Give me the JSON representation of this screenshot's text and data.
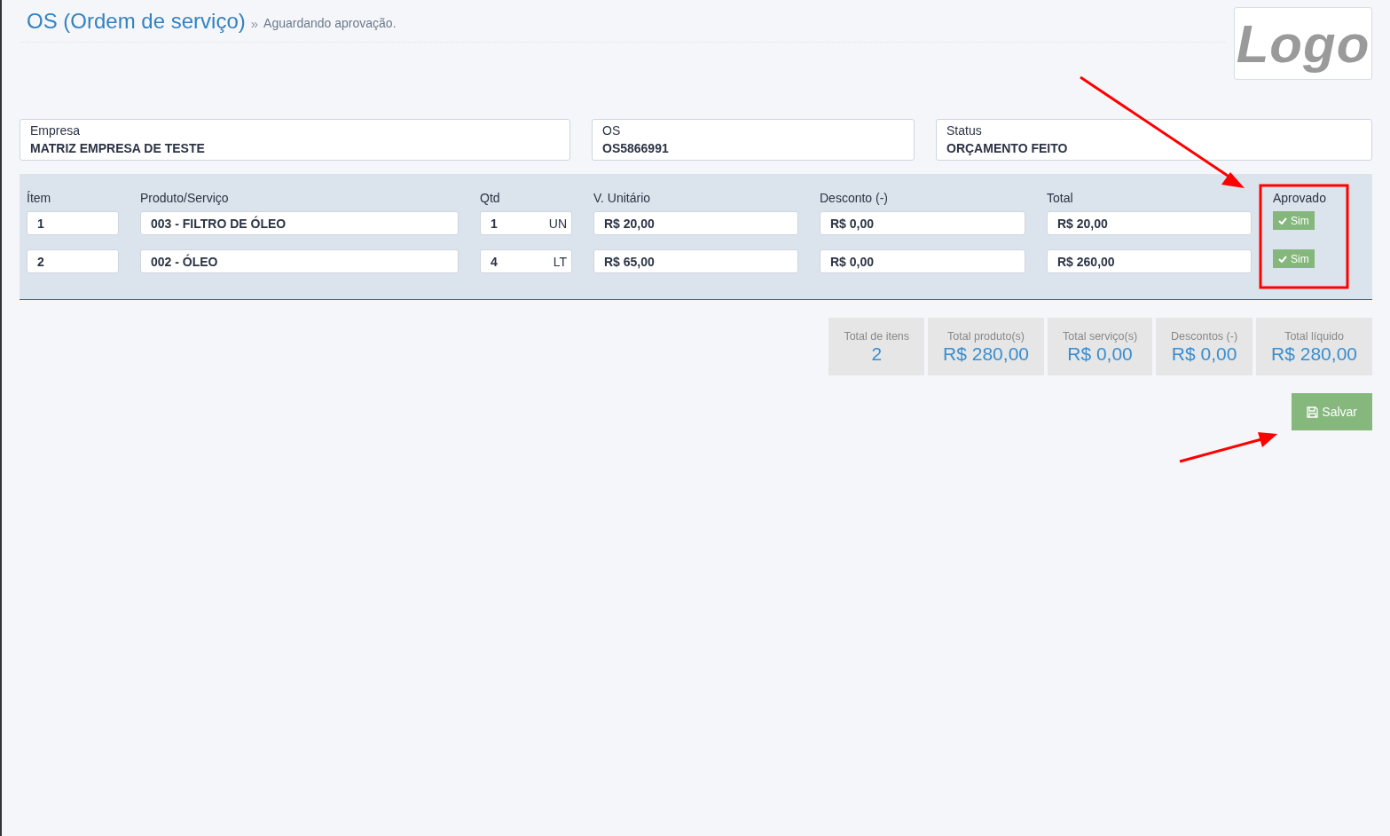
{
  "header": {
    "title": "OS (Ordem de serviço)",
    "separator": "»",
    "subtitle": "Aguardando aprovação.",
    "logo": "Logo"
  },
  "info": [
    {
      "label": "Empresa",
      "value": "MATRIZ EMPRESA DE TESTE"
    },
    {
      "label": "OS",
      "value": "OS5866991"
    },
    {
      "label": "Status",
      "value": "ORÇAMENTO FEITO"
    }
  ],
  "table": {
    "columns": [
      "Ítem",
      "Produto/Serviço",
      "Qtd",
      "V. Unitário",
      "Desconto (-)",
      "Total",
      "Aprovado"
    ],
    "rows": [
      {
        "item": "1",
        "product": "003 - FILTRO DE ÓLEO",
        "qty": "1",
        "unit": "UN",
        "unit_price": "R$ 20,00",
        "discount": "R$ 0,00",
        "total": "R$ 20,00",
        "approval": {
          "label": "Sim",
          "approved": true
        }
      },
      {
        "item": "2",
        "product": "002 - ÓLEO",
        "qty": "4",
        "unit": "LT",
        "unit_price": "R$ 65,00",
        "discount": "R$ 0,00",
        "total": "R$ 260,00",
        "approval": {
          "label": "Sim",
          "approved": true
        }
      }
    ]
  },
  "summary": [
    {
      "label": "Total de itens",
      "value": "2"
    },
    {
      "label": "Total produto(s)",
      "value": "R$ 280,00"
    },
    {
      "label": "Total serviço(s)",
      "value": "R$ 0,00"
    },
    {
      "label": "Descontos (-)",
      "value": "R$ 0,00"
    },
    {
      "label": "Total líquido",
      "value": "R$ 280,00"
    }
  ],
  "save_button": {
    "label": "Salvar"
  }
}
